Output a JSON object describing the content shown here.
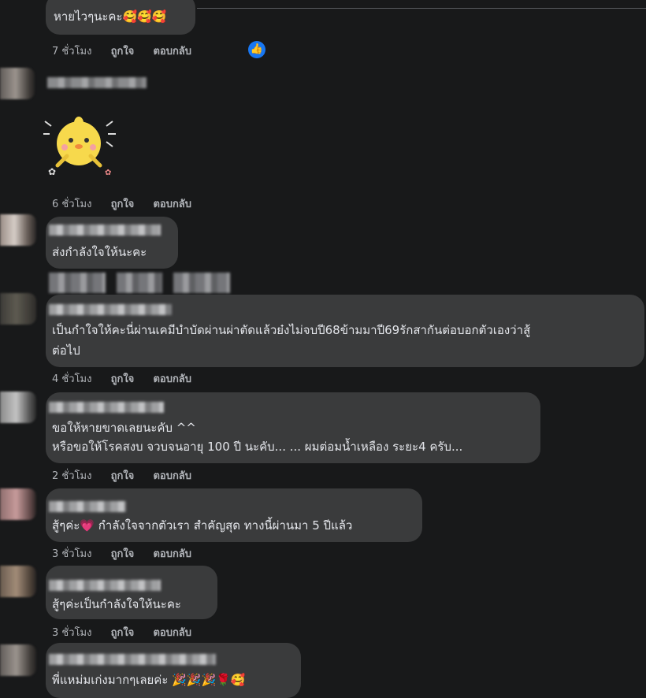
{
  "comments": [
    {
      "text": "หายไวๆนะคะ🥰🥰🥰",
      "time": "7 ชั่วโมง",
      "like": "ถูกใจ",
      "reply": "ตอบกลับ",
      "reaction_icon": "thumbs-up-icon"
    },
    {
      "sticker": "yellow-chick-sticker",
      "time": "6 ชั่วโมง",
      "like": "ถูกใจ",
      "reply": "ตอบกลับ"
    },
    {
      "text": "ส่งกำลังใจให้นะคะ"
    },
    {
      "text_line1": "เป็นกำใจให้คะนี่ผ่านเคมีบำบัดผ่านผ่าตัดแล้วย๋งไม่จบปี68ข้ามมาปี69รักสากันต่อบอกตัวเองว่าสู้",
      "text_line2": "ต่อไป",
      "time": "4 ชั่วโมง",
      "like": "ถูกใจ",
      "reply": "ตอบกลับ"
    },
    {
      "text_line1": "ขอให้หายขาดเลยนะคับ ^^",
      "text_line2": "หรือขอให้โรคสงบ จวบจนอายุ 100 ปี นะคับ... ... ผมต่อมน้ำเหลือง ระยะ4 ครับ...",
      "time": "2 ชั่วโมง",
      "like": "ถูกใจ",
      "reply": "ตอบกลับ"
    },
    {
      "text": "สู้ๆค่ะ💗 กำลังใจจากตัวเรา สำคัญสุด ทางนี้ผ่านมา 5 ปีแล้ว",
      "time": "3 ชั่วโมง",
      "like": "ถูกใจ",
      "reply": "ตอบกลับ"
    },
    {
      "text": "สู้ๆค่ะเป็นกำลังใจให้นะคะ",
      "time": "3 ชั่วโมง",
      "like": "ถูกใจ",
      "reply": "ตอบกลับ"
    },
    {
      "text": "พี่แหม่มเก่งมากๆเลยค่ะ 🎉🎉🎉🌹🥰"
    }
  ],
  "colors": {
    "background": "#18191a",
    "bubble": "#3a3b3c",
    "text": "#e4e6eb",
    "meta": "#b0b3b8",
    "like_blue": "#1877f2"
  }
}
